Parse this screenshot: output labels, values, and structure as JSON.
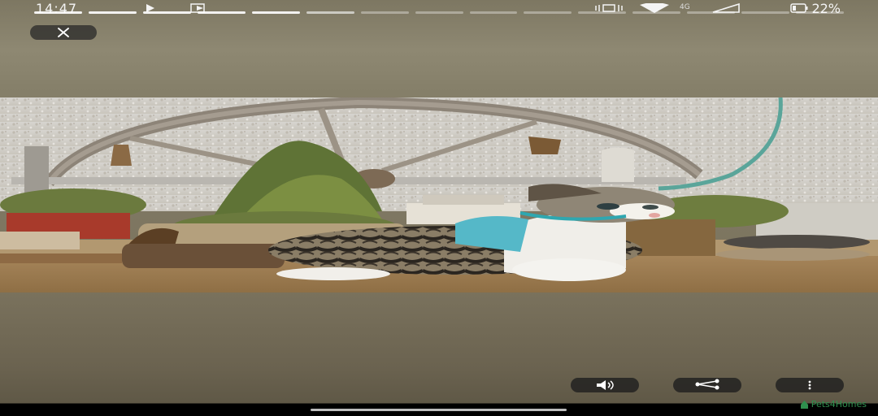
{
  "status_bar": {
    "time": "14:47",
    "network_label": "4G",
    "battery": "22%",
    "icons": [
      "play-icon",
      "cast-icon",
      "vibrate-icon",
      "wifi-icon",
      "signal-icon",
      "battery-icon"
    ]
  },
  "story": {
    "segment_count": 15,
    "completed_segments": 5,
    "active_segment": 5
  },
  "photo": {
    "subject": "kitten-photo"
  },
  "actions": {
    "close_icon": "close-icon",
    "mute_icon": "speaker-icon",
    "share_icon": "share-icon",
    "more_icon": "more-vertical-icon"
  },
  "watermark": {
    "text": "Pets4Homes",
    "color": "#2f8f4e"
  },
  "colors": {
    "background_top": "#8e8872",
    "background_bottom": "#6b6350",
    "button_bg": "#2a2a2a"
  }
}
